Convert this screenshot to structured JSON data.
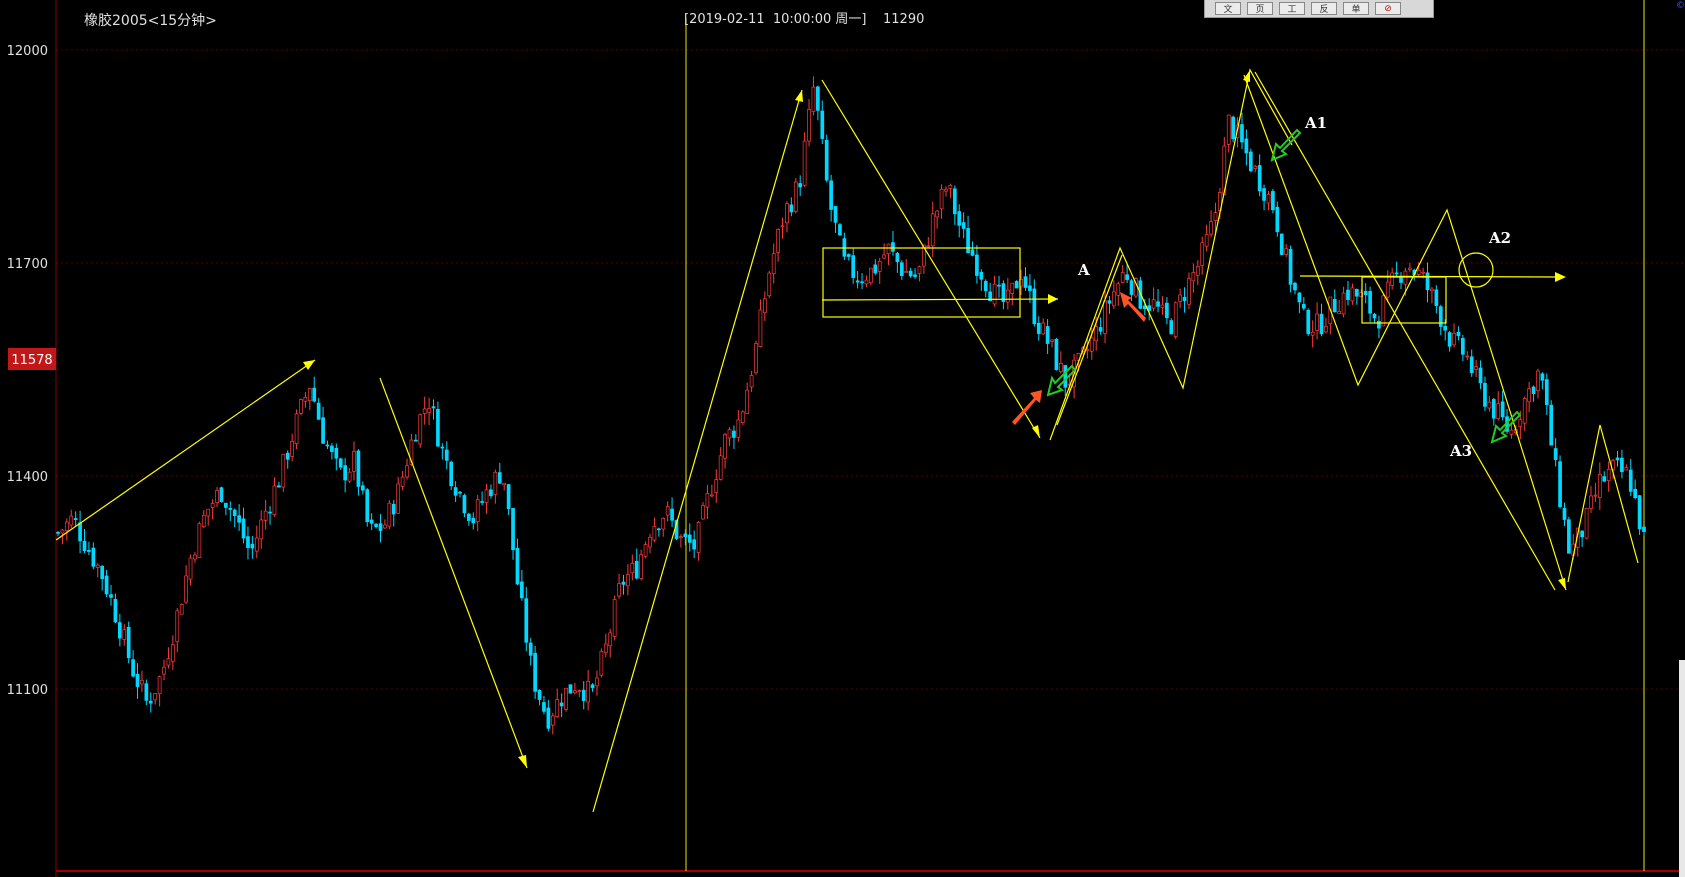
{
  "header": {
    "symbol": "橡胶2005<15分钟>",
    "cursor_info": "[2019-02-11  10:00:00 周一]    11290"
  },
  "price_badge": "11578",
  "toolbar": {
    "buttons": [
      "文",
      "页",
      "工",
      "反",
      "单",
      "⊘"
    ]
  },
  "colors": {
    "background": "#000000",
    "candle_up": "#ff3a3a",
    "candle_down": "#00d8ff",
    "annotation": "#ffff00",
    "grid": "#5a0000",
    "badge": "#c01818",
    "arrow_red": "#ff5522",
    "arrow_green": "#22cc22"
  },
  "labels": {
    "A": "A",
    "A1": "A1",
    "A2": "A2",
    "A3": "A3"
  },
  "chart_data": {
    "type": "candlestick",
    "title": "橡胶2005<15分钟>",
    "y_ticks": [
      12000,
      11700,
      11400,
      11100
    ],
    "y_range": [
      10950,
      12030
    ],
    "grid": true,
    "current_price": 11578,
    "note_vertical_line": "2019-02-11 10:00:00",
    "price_path_approx": [
      11320,
      11340,
      11300,
      11260,
      11200,
      11130,
      11080,
      11120,
      11200,
      11290,
      11350,
      11380,
      11340,
      11290,
      11350,
      11400,
      11470,
      11530,
      11450,
      11400,
      11420,
      11320,
      11330,
      11380,
      11460,
      11510,
      11430,
      11380,
      11340,
      11380,
      11410,
      11250,
      11120,
      11060,
      11090,
      11110,
      11090,
      11160,
      11250,
      11270,
      11330,
      11350,
      11310,
      11300,
      11380,
      11450,
      11480,
      11570,
      11690,
      11770,
      11810,
      11950,
      11790,
      11700,
      11680,
      11690,
      11720,
      11690,
      11680,
      11760,
      11810,
      11740,
      11700,
      11660,
      11640,
      11690,
      11620,
      11580,
      11530,
      11560,
      11600,
      11650,
      11690,
      11650,
      11640,
      11610,
      11660,
      11700,
      11760,
      11900,
      11860,
      11820,
      11780,
      11690,
      11620,
      11610,
      11640,
      11660,
      11650,
      11620,
      11670,
      11700,
      11680,
      11640,
      11590,
      11570,
      11520,
      11490,
      11460,
      11510,
      11550,
      11410,
      11290,
      11330,
      11390,
      11410,
      11400,
      11310
    ]
  }
}
